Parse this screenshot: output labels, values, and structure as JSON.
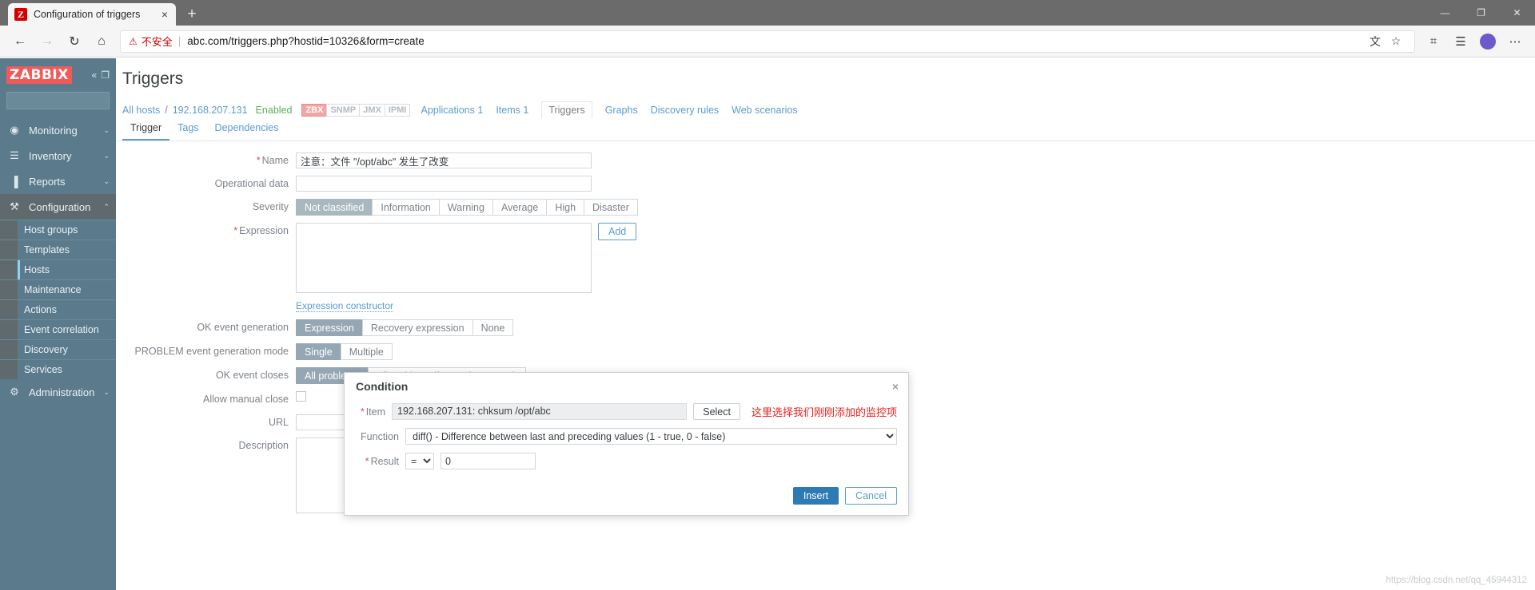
{
  "browser": {
    "tab": {
      "title": "Configuration of triggers",
      "favicon_letter": "Z",
      "close_icon": "×"
    },
    "newtab_icon": "+",
    "window_controls": {
      "minimize": "—",
      "maximize": "❐",
      "close": "✕"
    },
    "nav": {
      "back_icon": "←",
      "forward_icon": "→",
      "reload_icon": "↻",
      "home_icon": "⌂"
    },
    "omnibox": {
      "warning_icon": "⚠",
      "warning_text": "不安全",
      "separator": "|",
      "url": "abc.com/triggers.php?hostid=10326&form=create",
      "translate_icon": "文",
      "favorite_icon": "☆"
    },
    "toolbar": {
      "collections_icon": "☰",
      "favorites_bar_icon": "⌗",
      "settings_icon": "⋯"
    }
  },
  "sidebar": {
    "logo": "ZABBIX",
    "collapse_icon": "«",
    "hide_icon": "❐",
    "search_placeholder": "",
    "search_value": "",
    "search_icon": "⚲",
    "items": [
      {
        "label": "Monitoring",
        "icon": "◉",
        "chevron": "⌄",
        "active": false
      },
      {
        "label": "Inventory",
        "icon": "☰",
        "chevron": "⌄",
        "active": false
      },
      {
        "label": "Reports",
        "icon": "▐",
        "chevron": "⌄",
        "active": false
      },
      {
        "label": "Configuration",
        "icon": "⚒",
        "chevron": "⌃",
        "active": true
      }
    ],
    "subitems": [
      {
        "label": "Host groups",
        "selected": false
      },
      {
        "label": "Templates",
        "selected": false
      },
      {
        "label": "Hosts",
        "selected": true
      },
      {
        "label": "Maintenance",
        "selected": false
      },
      {
        "label": "Actions",
        "selected": false
      },
      {
        "label": "Event correlation",
        "selected": false
      },
      {
        "label": "Discovery",
        "selected": false
      },
      {
        "label": "Services",
        "selected": false
      }
    ],
    "admin": {
      "label": "Administration",
      "icon": "⚙",
      "chevron": "⌄"
    }
  },
  "page": {
    "title": "Triggers",
    "breadcrumb": {
      "all_hosts": "All hosts",
      "separator": "/",
      "host": "192.168.207.131",
      "status": "Enabled",
      "protocols": [
        {
          "label": "ZBX",
          "active": true
        },
        {
          "label": "SNMP",
          "active": false
        },
        {
          "label": "JMX",
          "active": false
        },
        {
          "label": "IPMI",
          "active": false
        }
      ],
      "links": [
        {
          "label": "Applications 1",
          "current": false
        },
        {
          "label": "Items 1",
          "current": false
        },
        {
          "label": "Triggers",
          "current": true
        },
        {
          "label": "Graphs",
          "current": false
        },
        {
          "label": "Discovery rules",
          "current": false
        },
        {
          "label": "Web scenarios",
          "current": false
        }
      ]
    },
    "form_tabs": [
      {
        "label": "Trigger",
        "active": true
      },
      {
        "label": "Tags",
        "active": false
      },
      {
        "label": "Dependencies",
        "active": false
      }
    ]
  },
  "form": {
    "name": {
      "label": "Name",
      "required": true,
      "value": "注意：文件 \"/opt/abc\" 发生了改变",
      "placeholder": ""
    },
    "operational_data": {
      "label": "Operational data",
      "required": false,
      "value": "",
      "placeholder": ""
    },
    "severity": {
      "label": "Severity",
      "options": [
        "Not classified",
        "Information",
        "Warning",
        "Average",
        "High",
        "Disaster"
      ],
      "selected": "Not classified"
    },
    "expression": {
      "label": "Expression",
      "required": true,
      "value": "",
      "add_button": "Add"
    },
    "expression_constructor": "Expression constructor",
    "ok_event_generation": {
      "label": "OK event generation",
      "options": [
        "Expression",
        "Recovery expression",
        "None"
      ],
      "selected": "Expression"
    },
    "problem_event_generation_mode": {
      "label": "PROBLEM event generation mode",
      "options": [
        "Single",
        "Multiple"
      ],
      "selected": "Single"
    },
    "ok_event_closes": {
      "label": "OK event closes",
      "options": [
        "All problems",
        "All problems if tag values match"
      ],
      "selected": "All problems"
    },
    "allow_manual_close": {
      "label": "Allow manual close",
      "checked": false
    },
    "url": {
      "label": "URL",
      "value": "",
      "placeholder": ""
    },
    "description": {
      "label": "Description",
      "value": "",
      "placeholder": ""
    }
  },
  "modal": {
    "title": "Condition",
    "close_icon": "×",
    "item": {
      "label": "Item",
      "required": true,
      "value": "192.168.207.131: chksum /opt/abc",
      "select_button": "Select"
    },
    "annotation": "这里选择我们刚刚添加的监控项",
    "function": {
      "label": "Function",
      "selected": "diff() - Difference between last and preceding values (1 - true, 0 - false)",
      "options": [
        "diff() - Difference between last and preceding values (1 - true, 0 - false)"
      ]
    },
    "result": {
      "label": "Result",
      "required": true,
      "operator": "=",
      "operator_options": [
        "=",
        "<>",
        ">",
        "<",
        ">=",
        "<="
      ],
      "value": "0"
    },
    "insert_button": "Insert",
    "cancel_button": "Cancel"
  },
  "watermark": "https://blog.csdn.net/qq_45944312"
}
